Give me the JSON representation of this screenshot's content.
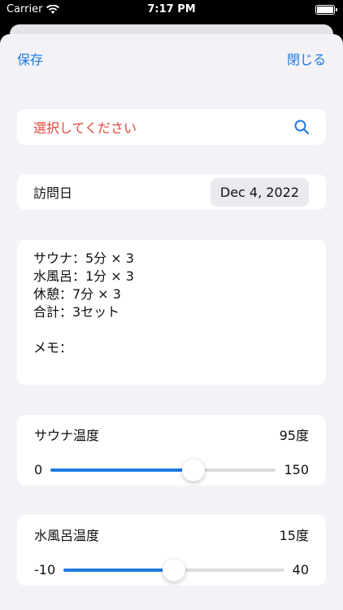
{
  "status_bar": {
    "carrier": "Carrier",
    "time": "7:17 PM"
  },
  "nav": {
    "save_label": "保存",
    "close_label": "閉じる"
  },
  "select": {
    "placeholder": "選択してください",
    "search_icon": "search-icon"
  },
  "visit_date": {
    "label": "訪問日",
    "value": "Dec 4, 2022"
  },
  "memo": {
    "text": "サウナ：5分 × 3\n水風呂：1分 × 3\n休憩：7分 × 3\n合計：3セット\n\nメモ："
  },
  "sauna_temp": {
    "label": "サウナ温度",
    "value_text": "95度",
    "min": "0",
    "max": "150",
    "value": 95,
    "range": [
      0,
      150
    ]
  },
  "water_temp": {
    "label": "水風呂温度",
    "value_text": "15度",
    "min": "-10",
    "max": "40",
    "value": 15,
    "range": [
      -10,
      40
    ]
  },
  "colors": {
    "accent": "#1f7ae0",
    "placeholder_red": "#e0463d",
    "background": "#f2f2f7"
  }
}
